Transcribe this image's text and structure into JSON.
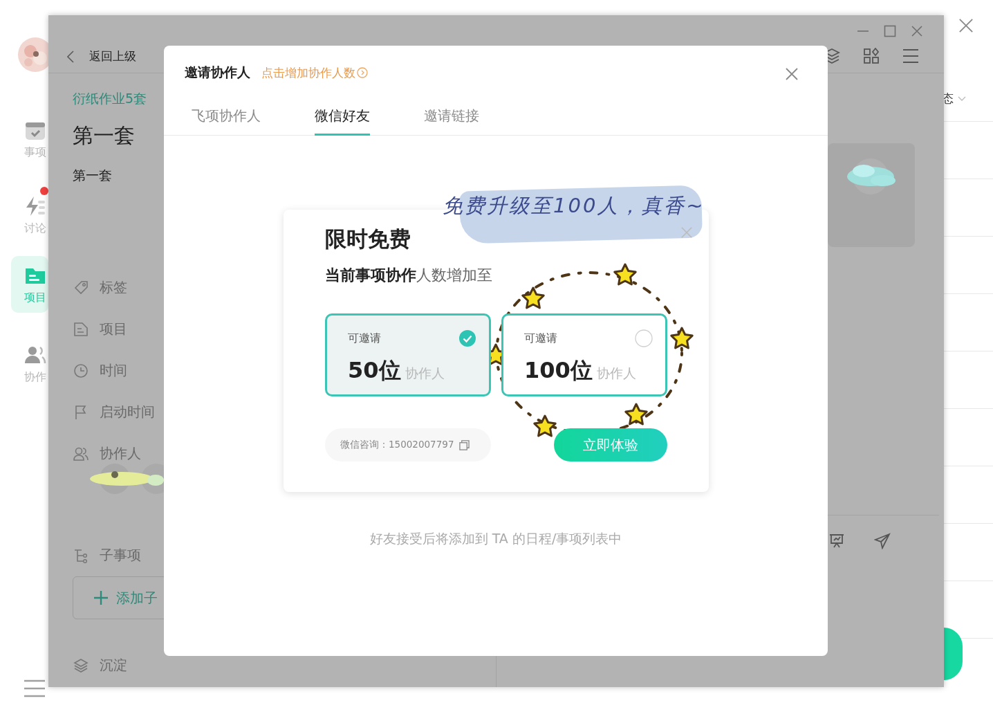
{
  "app": {
    "nav": [
      {
        "kind": "calendar",
        "label": "事项",
        "selected": false,
        "badge": false
      },
      {
        "kind": "bolt",
        "label": "讨论",
        "selected": false,
        "badge": true
      },
      {
        "kind": "folder",
        "label": "项目",
        "selected": true,
        "badge": false
      },
      {
        "kind": "people",
        "label": "协作",
        "selected": false,
        "badge": false
      }
    ],
    "status_filter": "态"
  },
  "detail_window": {
    "back": "返回上级",
    "project": "衍纸作业5套",
    "title": "第一套",
    "description": "第一套",
    "fields": [
      {
        "kind": "tag",
        "label": "标签"
      },
      {
        "kind": "doc",
        "label": "项目"
      },
      {
        "kind": "clock",
        "label": "时间"
      },
      {
        "kind": "flag",
        "label": "启动时间"
      },
      {
        "kind": "people",
        "label": "协作人"
      }
    ],
    "subtasks_label": "子事项",
    "add_subtask": "添加子",
    "archive": "沉淀"
  },
  "dialog": {
    "title": "邀请协作人",
    "upgrade_link": "点击增加协作人数",
    "tabs": [
      {
        "label": "飞项协作人",
        "selected": false
      },
      {
        "label": "微信好友",
        "selected": true
      },
      {
        "label": "邀请链接",
        "selected": false
      }
    ],
    "hint": "好友接受后将添加到 TA 的日程/事项列表中"
  },
  "promo": {
    "banner": "免费升级至100人，真香~",
    "title": "限时免费",
    "subtitle": "**当前事项协作**人数增加至",
    "options": [
      {
        "caption": "可邀请",
        "amount": "50位",
        "unit": "协作人",
        "selected": true
      },
      {
        "caption": "可邀请",
        "amount": "100位",
        "unit": "协作人",
        "selected": false
      }
    ],
    "contact": "微信咨询：15002007797",
    "cta": "立即体验"
  }
}
